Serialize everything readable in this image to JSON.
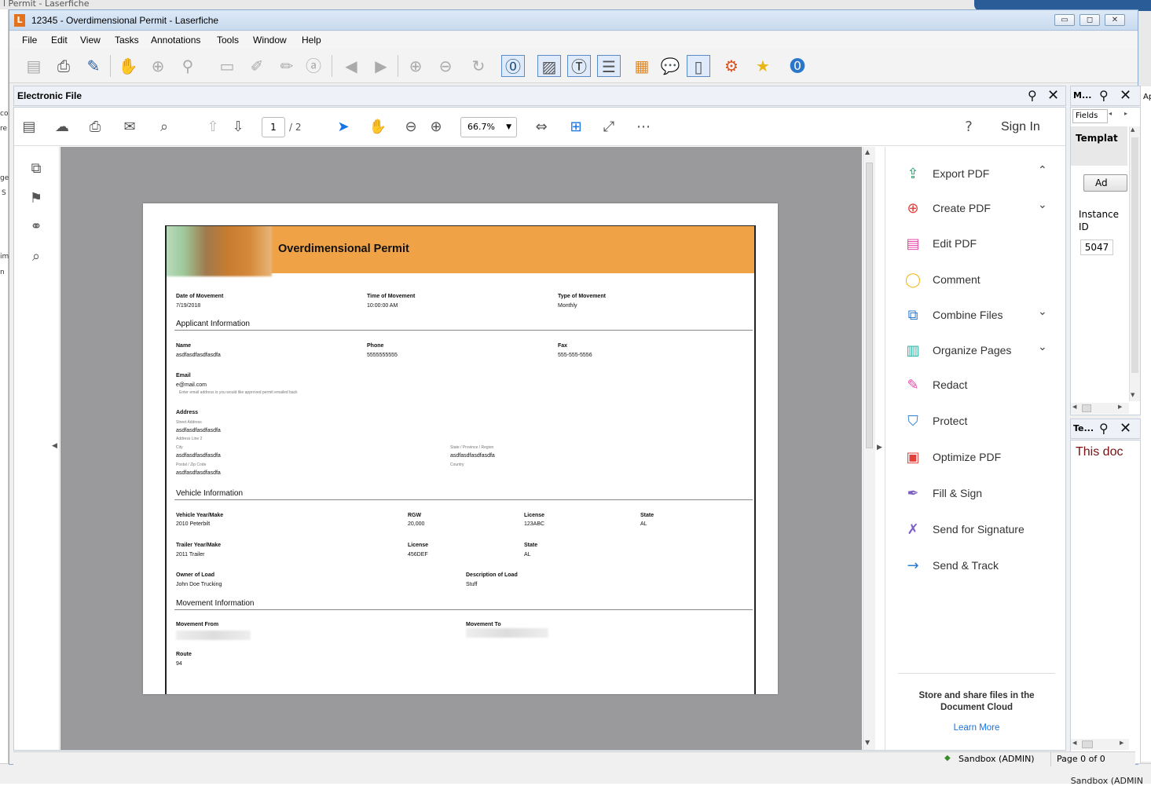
{
  "background": {
    "title": "l Permit - Laserfiche",
    "right_status": "Sandbox (ADMIN",
    "left_strip_chars": [
      "co",
      "re",
      "ge",
      "S",
      "im",
      "n"
    ],
    "right_strip_char": "Ap"
  },
  "window": {
    "title": "12345 - Overdimensional Permit - Laserfiche",
    "logo": "L",
    "min": "▭",
    "max": "◻",
    "close": "✕"
  },
  "menu": [
    "File",
    "Edit",
    "View",
    "Tasks",
    "Annotations",
    "Tools",
    "Window",
    "Help"
  ],
  "electronic_file": {
    "title": "Electronic File",
    "acrobat": {
      "page_current": "1",
      "page_total": "/ 2",
      "zoom": "66.7%",
      "sign_in": "Sign In"
    },
    "tools": [
      {
        "label": "Export PDF",
        "icon": "export-pdf-icon",
        "glyph": "⇪",
        "color": "#2e9e6b",
        "chevron": "⌃"
      },
      {
        "label": "Create PDF",
        "icon": "create-pdf-icon",
        "glyph": "⊕",
        "color": "#e0413b",
        "chevron": "⌄"
      },
      {
        "label": "Edit PDF",
        "icon": "edit-pdf-icon",
        "glyph": "▤",
        "color": "#e64aa8",
        "chevron": ""
      },
      {
        "label": "Comment",
        "icon": "comment-icon",
        "glyph": "◯",
        "color": "#f4b920",
        "chevron": ""
      },
      {
        "label": "Combine Files",
        "icon": "combine-files-icon",
        "glyph": "⧉",
        "color": "#2d7cd0",
        "chevron": "⌄"
      },
      {
        "label": "Organize Pages",
        "icon": "organize-pages-icon",
        "glyph": "▥",
        "color": "#2bb3a0",
        "chevron": "⌄"
      },
      {
        "label": "Redact",
        "icon": "redact-icon",
        "glyph": "✎",
        "color": "#e64aa8",
        "chevron": ""
      },
      {
        "label": "Protect",
        "icon": "protect-icon",
        "glyph": "⛉",
        "color": "#2d7cd0",
        "chevron": ""
      },
      {
        "label": "Optimize PDF",
        "icon": "optimize-pdf-icon",
        "glyph": "▣",
        "color": "#e0413b",
        "chevron": ""
      },
      {
        "label": "Fill & Sign",
        "icon": "fill-sign-icon",
        "glyph": "✒",
        "color": "#7b5fc7",
        "chevron": ""
      },
      {
        "label": "Send for Signature",
        "icon": "send-for-signature-icon",
        "glyph": "✗",
        "color": "#7b5fc7",
        "chevron": ""
      },
      {
        "label": "Send & Track",
        "icon": "send-track-icon",
        "glyph": "→",
        "color": "#2d7cd0",
        "chevron": ""
      }
    ],
    "cloud_text": "Store and share files in the Document Cloud",
    "learn_more": "Learn More"
  },
  "pdf": {
    "title": "Overdimensional Permit",
    "date_label": "Date of Movement",
    "date_value": "7/19/2018",
    "time_label": "Time of Movement",
    "time_value": "10:00:00 AM",
    "type_label": "Type of Movement",
    "type_value": "Monthly",
    "sec_applicant": "Applicant Information",
    "name_label": "Name",
    "name_value": "asdfasdfasdfasdfa",
    "phone_label": "Phone",
    "phone_value": "5555555555",
    "fax_label": "Fax",
    "fax_value": "555-555-5556",
    "email_label": "Email",
    "email_value": "e@mail.com",
    "email_hint": "Enter email address is you would like approved permit emailed back",
    "address_label": "Address",
    "street_sub": "Street Address",
    "street_value": "asdfasdfasdfasdfa",
    "line2_sub": "Address Line 2",
    "city_sub": "City",
    "city_value": "asdfasdfasdfasdfa",
    "state_sub": "State / Province / Region",
    "state_value": "asdfasdfasdfasdfa",
    "zip_sub": "Postal / Zip Code",
    "zip_value": "asdfasdfasdfasdfa",
    "country_sub": "Country",
    "sec_vehicle": "Vehicle Information",
    "vym_label": "Vehicle Year/Make",
    "vym_value": "2010 Peterbilt",
    "rgw_label": "RGW",
    "rgw_value": "20,000",
    "lic1_label": "License",
    "lic1_value": "123ABC",
    "st1_label": "State",
    "st1_value": "AL",
    "tym_label": "Trailer Year/Make",
    "tym_value": "2011 Trailer",
    "lic2_label": "License",
    "lic2_value": "456DEF",
    "st2_label": "State",
    "st2_value": "AL",
    "owner_label": "Owner of Load",
    "owner_value": "John Doe Trucking",
    "desc_label": "Description of Load",
    "desc_value": "Stuff",
    "sec_movement": "Movement Information",
    "from_label": "Movement From",
    "to_label": "Movement To",
    "route_label": "Route",
    "route_value": "94"
  },
  "meta_pane": {
    "title": "M...",
    "fields_tab": "Fields",
    "template_label": "Templat",
    "add_button": "Ad",
    "instance_label": "Instance ID",
    "instance_value": "5047"
  },
  "text_pane": {
    "title": "Te...",
    "body": "This doc"
  },
  "status": {
    "repo": "Sandbox (ADMIN)",
    "page": "Page 0 of 0"
  }
}
